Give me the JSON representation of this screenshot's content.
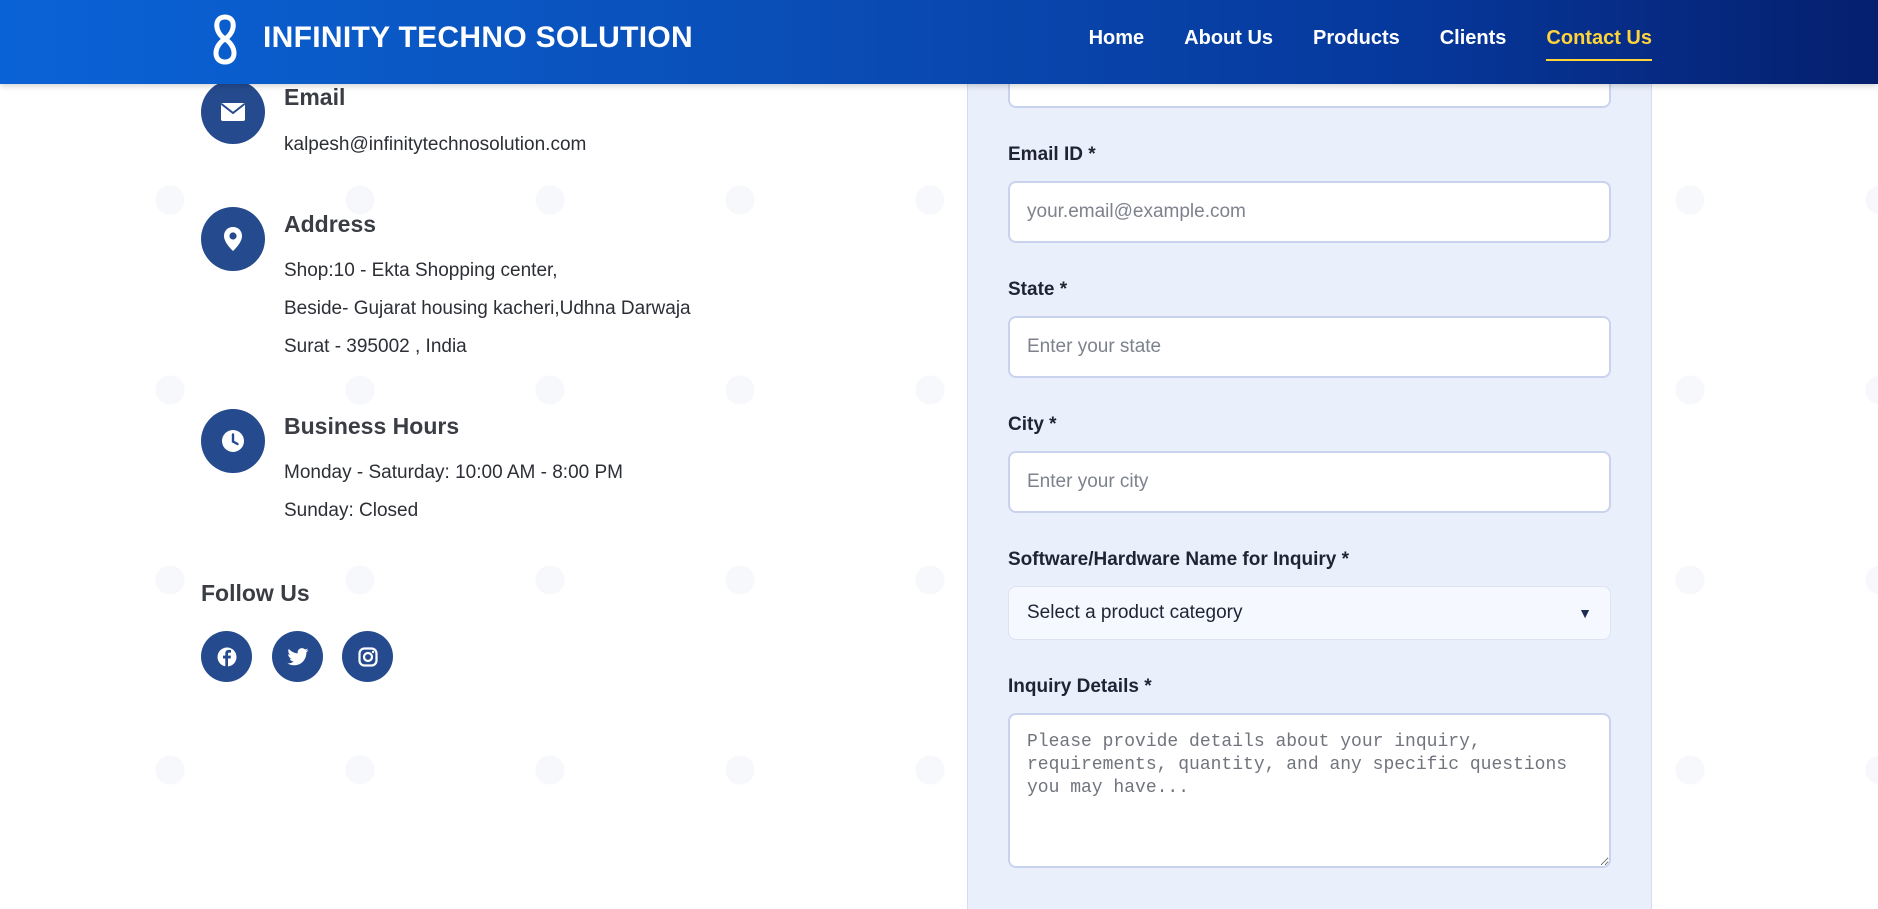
{
  "header": {
    "brand": "INFINITY TECHNO SOLUTION",
    "logo_icon": "infinity-8-logo",
    "nav": [
      {
        "label": "Home",
        "active": false
      },
      {
        "label": "About Us",
        "active": false
      },
      {
        "label": "Products",
        "active": false
      },
      {
        "label": "Clients",
        "active": false
      },
      {
        "label": "Contact Us",
        "active": true
      }
    ]
  },
  "contact": {
    "email": {
      "icon": "envelope-icon",
      "title": "Email",
      "value": "kalpesh@infinitytechnosolution.com"
    },
    "address": {
      "icon": "location-pin-icon",
      "title": "Address",
      "lines": [
        "Shop:10 - Ekta Shopping center,",
        "Beside- Gujarat housing kacheri,Udhna Darwaja",
        "Surat - 395002 , India"
      ]
    },
    "hours": {
      "icon": "clock-icon",
      "title": "Business Hours",
      "lines": [
        "Monday - Saturday: 10:00 AM - 8:00 PM",
        "Sunday: Closed"
      ]
    },
    "follow": {
      "title": "Follow Us",
      "socials": [
        "facebook-icon",
        "twitter-icon",
        "instagram-icon"
      ]
    }
  },
  "form": {
    "email": {
      "label": "Email ID *",
      "placeholder": "your.email@example.com",
      "value": ""
    },
    "state": {
      "label": "State *",
      "placeholder": "Enter your state",
      "value": ""
    },
    "city": {
      "label": "City *",
      "placeholder": "Enter your city",
      "value": ""
    },
    "product": {
      "label": "Software/Hardware Name for Inquiry *",
      "selected": "Select a product category"
    },
    "details": {
      "label": "Inquiry Details *",
      "placeholder": "Please provide details about your inquiry, requirements, quantity, and any specific questions you may have...",
      "value": ""
    }
  },
  "colors": {
    "header_start": "#0a63d6",
    "header_end": "#051f6e",
    "nav_active": "#ffd43b",
    "icon_circle": "#254b8e",
    "form_bg": "#eaeffc"
  }
}
